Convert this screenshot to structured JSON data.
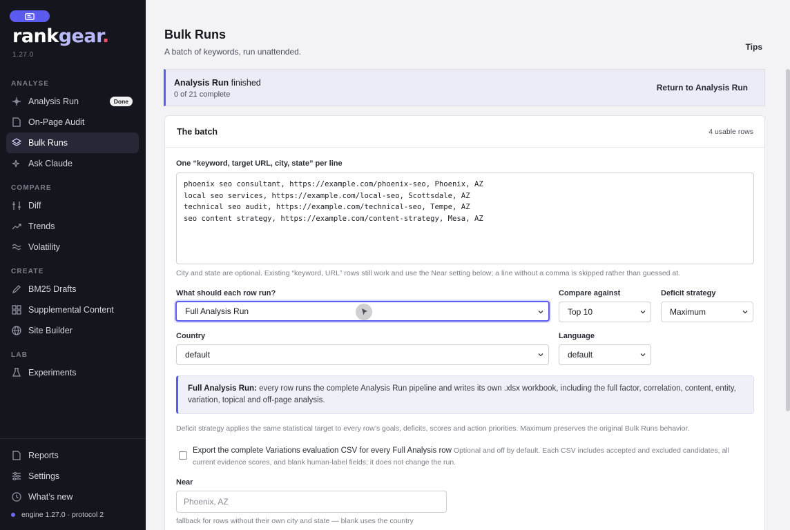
{
  "sidebar": {
    "logo": {
      "part1": "rank",
      "part2": "gear",
      "dot": "."
    },
    "version": "1.27.0",
    "sections": {
      "analyse": "ANALYSE",
      "compare": "COMPARE",
      "create": "CREATE",
      "lab": "LAB"
    },
    "items": {
      "analysis_run": {
        "label": "Analysis Run",
        "badge": "Done",
        "icon": "sparkle-icon"
      },
      "on_page_audit": {
        "label": "On-Page Audit",
        "icon": "document-icon"
      },
      "bulk_runs": {
        "label": "Bulk Runs",
        "icon": "layers-icon"
      },
      "ask_claude": {
        "label": "Ask Claude",
        "icon": "sparkles-icon"
      },
      "diff": {
        "label": "Diff",
        "icon": "sliders-icon"
      },
      "trends": {
        "label": "Trends",
        "icon": "trend-icon"
      },
      "volatility": {
        "label": "Volatility",
        "icon": "wave-icon"
      },
      "bm25": {
        "label": "BM25 Drafts",
        "icon": "pencil-icon"
      },
      "supplemental": {
        "label": "Supplemental Content",
        "icon": "grid-icon"
      },
      "site_builder": {
        "label": "Site Builder",
        "icon": "globe-icon"
      },
      "experiments": {
        "label": "Experiments",
        "icon": "flask-icon"
      },
      "reports": {
        "label": "Reports",
        "icon": "document-icon"
      },
      "settings": {
        "label": "Settings",
        "icon": "settings-icon"
      },
      "whats_new": {
        "label": "What’s new",
        "icon": "clock-icon"
      }
    },
    "engine": "engine 1.27.0 · protocol 2"
  },
  "header": {
    "title": "Bulk Runs",
    "subtitle": "A batch of keywords, run unattended.",
    "tips": "Tips"
  },
  "banner": {
    "title_bold": "Analysis Run",
    "title_rest": " finished",
    "progress": "0 of 21 complete",
    "action": "Return to Analysis Run"
  },
  "batch": {
    "title": "The batch",
    "meta": "4 usable rows",
    "input_label": "One “keyword, target URL, city, state” per line",
    "lines": "phoenix seo consultant, https://example.com/phoenix-seo, Phoenix, AZ\nlocal seo services, https://example.com/local-seo, Scottsdale, AZ\ntechnical seo audit, https://example.com/technical-seo, Tempe, AZ\nseo content strategy, https://example.com/content-strategy, Mesa, AZ",
    "input_help": "City and state are optional. Existing “keyword, URL” rows still work and use the Near setting below; a line without a comma is skipped rather than guessed at.",
    "run_label": "What should each row run?",
    "run_value": "Full Analysis Run",
    "compare_label": "Compare against",
    "compare_value": "Top 10",
    "deficit_label": "Deficit strategy",
    "deficit_value": "Maximum",
    "country_label": "Country",
    "country_value": "default",
    "language_label": "Language",
    "language_value": "default",
    "info_bold": "Full Analysis Run:",
    "info_text": " every row runs the complete Analysis Run pipeline and writes its own .xlsx workbook, including the full factor, correlation, content, entity, variation, topical and off-page analysis.",
    "deficit_help": "Deficit strategy applies the same statistical target to every row’s goals, deficits, scores and action priorities. Maximum preserves the original Bulk Runs behavior.",
    "export_label": "Export the complete Variations evaluation CSV for every Full Analysis row",
    "export_help": " Optional and off by default. Each CSV includes accepted and excluded candidates, all current evidence scores, and blank human-label fields; it does not change the run.",
    "near_label": "Near",
    "near_placeholder": "Phoenix, AZ",
    "near_help": "fallback for rows without their own city and state — blank uses the country"
  },
  "colors": {
    "accent": "#5b5bf0",
    "sidebar": "#15161d",
    "logo_dot": "#ff4f6a"
  }
}
